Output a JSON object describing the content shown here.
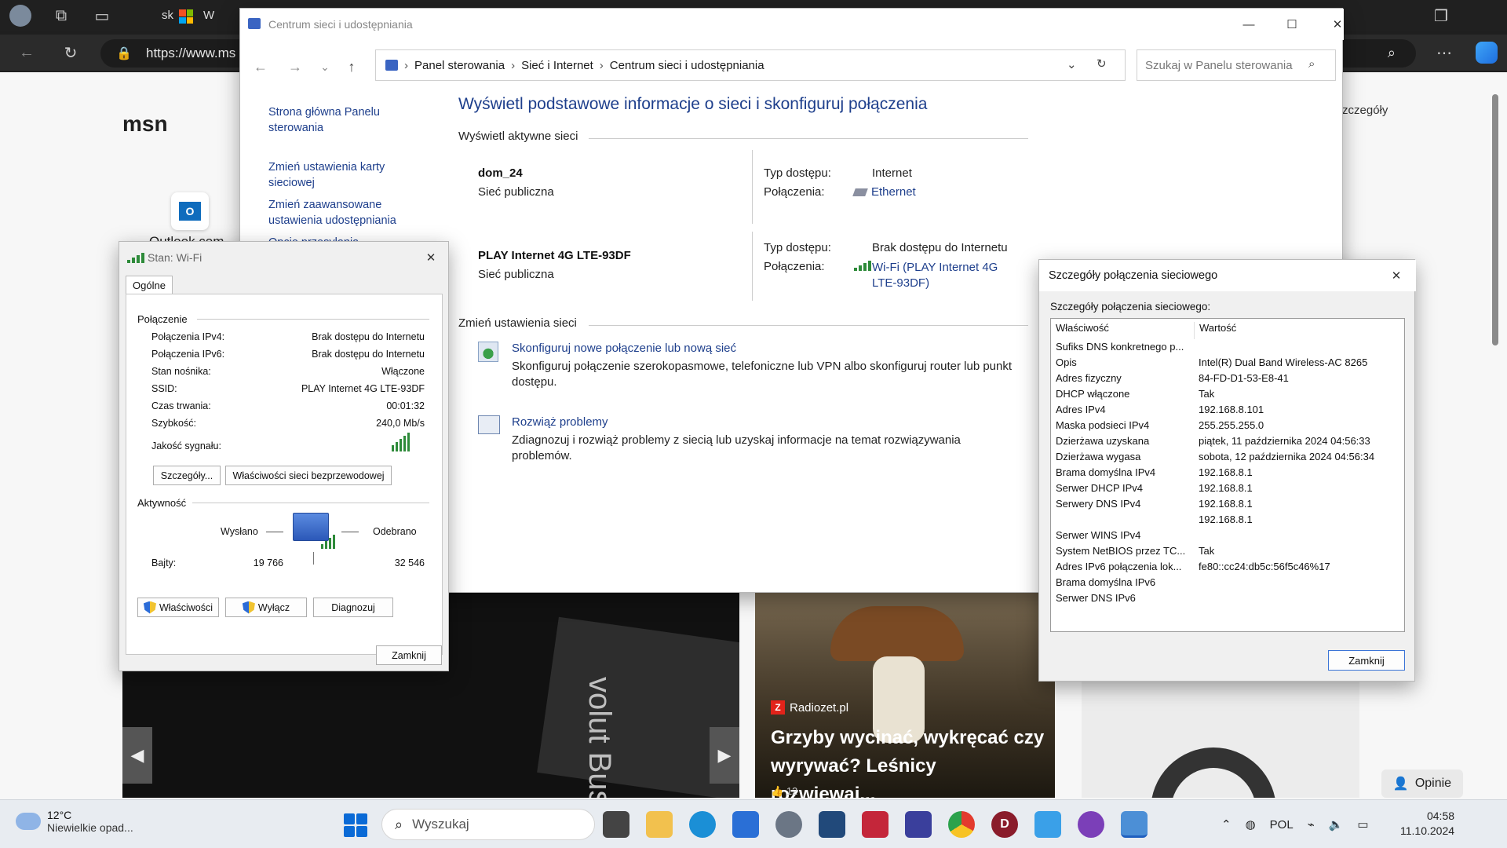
{
  "browser": {
    "url": "https://www.ms",
    "msn_logo": "msn",
    "outlook_label": "Outlook.com",
    "details_link": "Szczegóły",
    "tab_short_1": "sk",
    "tab_short_2": "W",
    "card_text": "volut Business",
    "news_source": "Radiozet.pl",
    "news_title": "Grzyby wycinać, wykręcać czy wyrywać? Leśnicy rozwiewaj...",
    "news_likes": "12",
    "opinie": "Opinie"
  },
  "control_panel": {
    "title": "Centrum sieci i udostępniania",
    "breadcrumb": [
      "Panel sterowania",
      "Sieć i Internet",
      "Centrum sieci i udostępniania"
    ],
    "search_placeholder": "Szukaj w Panelu sterowania",
    "sidebar_links": [
      "Strona główna Panelu sterowania",
      "Zmień ustawienia karty sieciowej",
      "Zmień zaawansowane ustawienia udostępniania",
      "Opcje przesyłania"
    ],
    "heading": "Wyświetl podstawowe informacje o sieci i skonfiguruj połączenia",
    "active_networks_label": "Wyświetl aktywne sieci",
    "access_type_label": "Typ dostępu:",
    "connections_label": "Połączenia:",
    "networks": [
      {
        "name": "dom_24",
        "type": "Sieć publiczna",
        "access": "Internet",
        "connection": "Ethernet"
      },
      {
        "name": "PLAY Internet 4G LTE-93DF",
        "type": "Sieć publiczna",
        "access": "Brak dostępu do Internetu",
        "connection": "Wi-Fi (PLAY Internet 4G LTE-93DF)"
      }
    ],
    "change_settings_label": "Zmień ustawienia sieci",
    "tasks": [
      {
        "title": "Skonfiguruj nowe połączenie lub nową sieć",
        "desc": "Skonfiguruj połączenie szerokopasmowe, telefoniczne lub VPN albo skonfiguruj router lub punkt dostępu."
      },
      {
        "title": "Rozwiąż problemy",
        "desc": "Zdiagnozuj i rozwiąż problemy z siecią lub uzyskaj informacje na temat rozwiązywania problemów."
      }
    ]
  },
  "wifi_status": {
    "title": "Stan: Wi-Fi",
    "tab": "Ogólne",
    "connection_group": "Połączenie",
    "rows": [
      {
        "k": "Połączenia IPv4:",
        "v": "Brak dostępu do Internetu"
      },
      {
        "k": "Połączenia IPv6:",
        "v": "Brak dostępu do Internetu"
      },
      {
        "k": "Stan nośnika:",
        "v": "Włączone"
      },
      {
        "k": "SSID:",
        "v": "PLAY Internet 4G LTE-93DF"
      },
      {
        "k": "Czas trwania:",
        "v": "00:01:32"
      },
      {
        "k": "Szybkość:",
        "v": "240,0 Mb/s"
      }
    ],
    "signal_label": "Jakość sygnału:",
    "btn_details": "Szczegóły...",
    "btn_wireless": "Właściwości sieci bezprzewodowej",
    "activity_group": "Aktywność",
    "sent": "Wysłano",
    "received": "Odebrano",
    "bytes_label": "Bajty:",
    "bytes_sent": "19 766",
    "bytes_received": "32 546",
    "btn_properties": "Właściwości",
    "btn_disable": "Wyłącz",
    "btn_diagnose": "Diagnozuj",
    "btn_close": "Zamknij"
  },
  "details": {
    "title": "Szczegóły połączenia sieciowego",
    "subtitle": "Szczegóły połączenia sieciowego:",
    "col_property": "Właściwość",
    "col_value": "Wartość",
    "rows": [
      {
        "k": "Sufiks DNS konkretnego p...",
        "v": ""
      },
      {
        "k": "Opis",
        "v": "Intel(R) Dual Band Wireless-AC 8265"
      },
      {
        "k": "Adres fizyczny",
        "v": "84-FD-D1-53-E8-41"
      },
      {
        "k": "DHCP włączone",
        "v": "Tak"
      },
      {
        "k": "Adres IPv4",
        "v": "192.168.8.101"
      },
      {
        "k": "Maska podsieci IPv4",
        "v": "255.255.255.0"
      },
      {
        "k": "Dzierżawa uzyskana",
        "v": "piątek, 11 października 2024 04:56:33"
      },
      {
        "k": "Dzierżawa wygasa",
        "v": "sobota, 12 października 2024 04:56:34"
      },
      {
        "k": "Brama domyślna IPv4",
        "v": "192.168.8.1"
      },
      {
        "k": "Serwer DHCP IPv4",
        "v": "192.168.8.1"
      },
      {
        "k": "Serwery DNS IPv4",
        "v": "192.168.8.1"
      },
      {
        "k": "",
        "v": "192.168.8.1"
      },
      {
        "k": "Serwer WINS IPv4",
        "v": ""
      },
      {
        "k": "System NetBIOS przez TC...",
        "v": "Tak"
      },
      {
        "k": "Adres IPv6 połączenia lok...",
        "v": "fe80::cc24:db5c:56f5c46%17"
      },
      {
        "k": "Brama domyślna IPv6",
        "v": ""
      },
      {
        "k": "Serwer DNS IPv6",
        "v": ""
      }
    ],
    "btn_close": "Zamknij"
  },
  "taskbar": {
    "temperature": "12°C",
    "weather": "Niewielkie opad...",
    "search": "Wyszukaj",
    "language": "POL",
    "time": "04:58",
    "date": "11.10.2024"
  }
}
